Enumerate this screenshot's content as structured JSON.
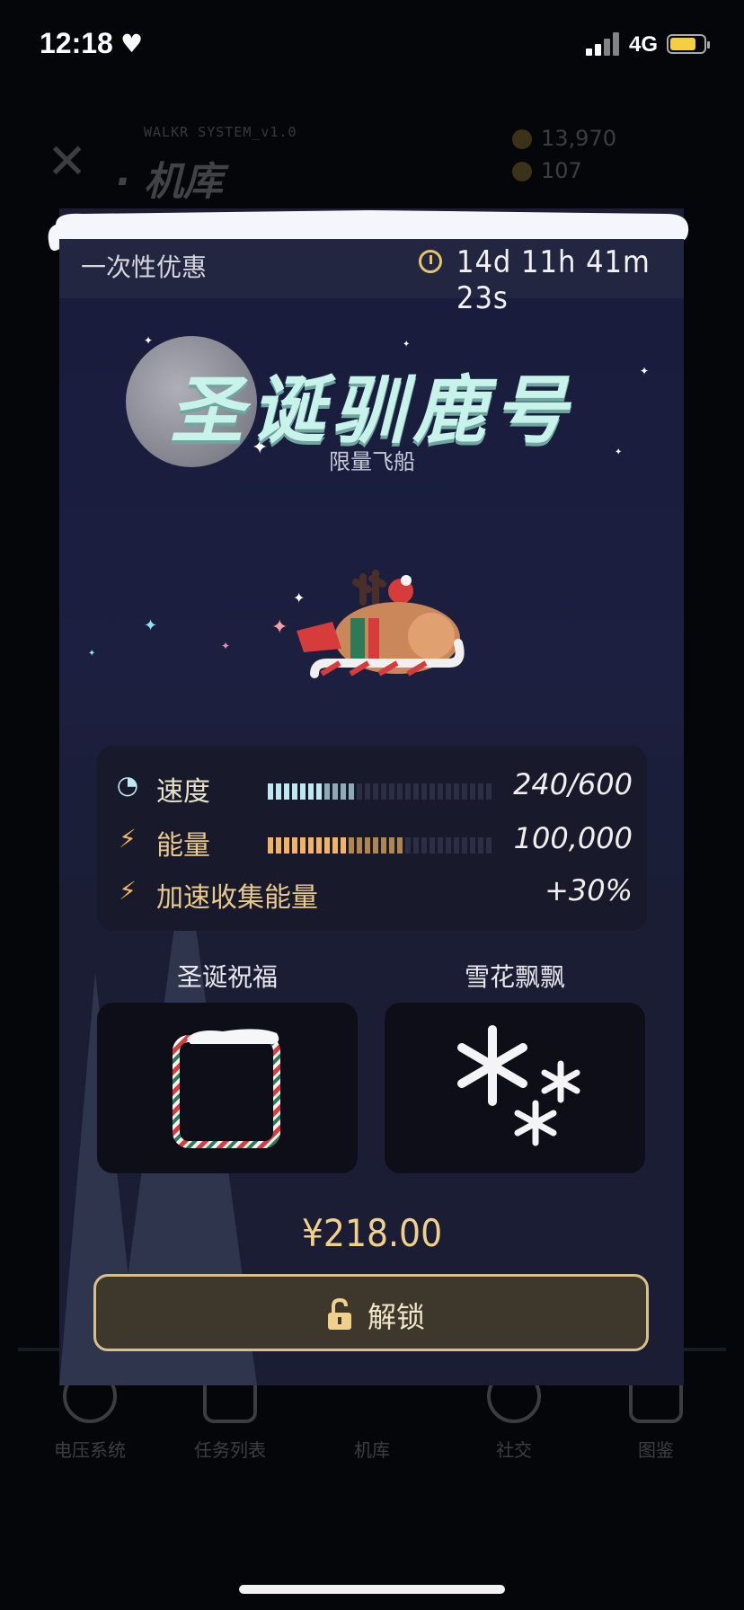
{
  "status_bar": {
    "time": "12:18",
    "network": "4G"
  },
  "background_app": {
    "system_label": "WALKR SYSTEM_v1.0",
    "title": "· 机库",
    "coins": "13,970",
    "gems": "107",
    "nav": [
      "电压系统",
      "任务列表",
      "机库",
      "社交",
      "图鉴"
    ]
  },
  "header": {
    "offer_label": "一次性优惠",
    "countdown": "14d 11h 41m 23s"
  },
  "ship": {
    "name": "圣诞驯鹿号",
    "subtitle": "限量飞船"
  },
  "stats": [
    {
      "label": "速度",
      "value": "240/600",
      "bar_fraction": 0.4,
      "bar_color": "#bfe9f2",
      "icon": "gauge-icon"
    },
    {
      "label": "能量",
      "value": "100,000",
      "bar_fraction": 0.6,
      "bar_color": "#f0b463",
      "icon": "lightning-icon"
    },
    {
      "label": "加速收集能量",
      "value": "+30%",
      "icon": "boost-lightning-icon"
    }
  ],
  "effects": [
    {
      "title": "圣诞祝福",
      "icon": "candy-cane-frame-icon"
    },
    {
      "title": "雪花飘飘",
      "icon": "snowflakes-icon"
    }
  ],
  "price": "¥218.00",
  "unlock_button": {
    "label": "解锁"
  },
  "colors": {
    "accent_gold": "#e6c46b",
    "title_mint": "#c8f3ea",
    "modal_bg": "#1a1d33"
  }
}
